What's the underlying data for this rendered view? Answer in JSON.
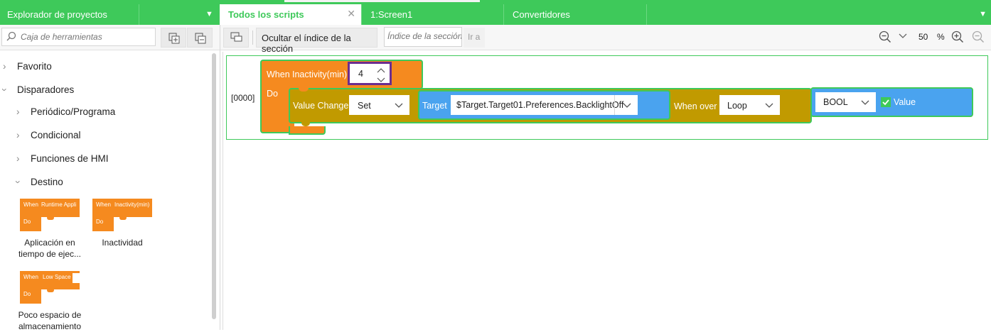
{
  "explorer": {
    "title": "Explorador de proyectos",
    "menu_icon": "menu-caret-icon"
  },
  "tabs": [
    {
      "label": "Todos los scripts",
      "active": true,
      "close": "✕"
    },
    {
      "label": "1:Screen1"
    },
    {
      "label": "Convertidores"
    }
  ],
  "toolbox": {
    "search_placeholder": "Caja de herramientas"
  },
  "tree": {
    "favorito": "Favorito",
    "disparadores": "Disparadores",
    "periodico": "Periódico/Programa",
    "condicional": "Condicional",
    "funciones": "Funciones de HMI",
    "destino": "Destino"
  },
  "thumbnails": [
    {
      "when": "When",
      "param": "Runtime Appli",
      "do": "Do",
      "label1": "Aplicación en",
      "label2": "tiempo de ejec..."
    },
    {
      "when": "When",
      "param": "Inactivity(min)",
      "do": "Do",
      "label1": "Inactividad",
      "label2": ""
    },
    {
      "when": "When",
      "param": "Low Space",
      "do": "Do",
      "label1": "Poco espacio de",
      "label2": "almacenamiento"
    }
  ],
  "script_toolbar": {
    "hide_index": "Ocultar el índice de la sección",
    "section_placeholder": "Índice de la sección",
    "go": "Ir a",
    "zoom_value": "50",
    "zoom_unit": "%"
  },
  "script": {
    "index": "[0000]",
    "when": "When",
    "do": "Do",
    "param_label": "Inactivity(min)",
    "param_value": "4",
    "value_change": "Value Change",
    "set": "Set",
    "target_label": "Target",
    "target_value": "$Target.Target01.Preferences.BacklightOff",
    "when_over": "When over",
    "loop": "Loop",
    "bool": "BOOL",
    "value": "Value"
  },
  "colors": {
    "green": "#3ec95a",
    "orange": "#f58a1f",
    "olive": "#c19a00",
    "blue": "#4aa3ef",
    "highlight": "#6b2d8f"
  }
}
